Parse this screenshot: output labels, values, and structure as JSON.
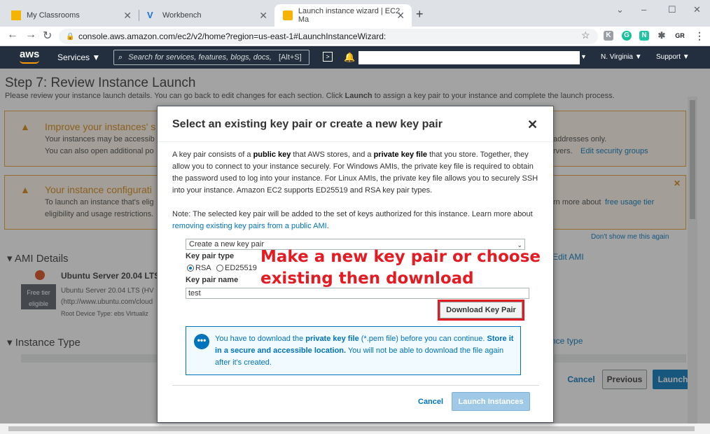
{
  "browser": {
    "tabs": [
      {
        "title": "My Classrooms"
      },
      {
        "title": "Workbench"
      },
      {
        "title": "Launch instance wizard | EC2 Ma"
      }
    ],
    "new_tab": "+",
    "window_controls": {
      "chevron": "⌄",
      "minimize": "–",
      "maximize": "☐",
      "close": "✕"
    },
    "url": "console.aws.amazon.com/ec2/v2/home?region=us-east-1#LaunchInstanceWizard:",
    "extensions": [
      {
        "letter": "K",
        "color": "#5f6368"
      },
      {
        "letter": "G",
        "color": "#15c39a"
      },
      {
        "letter": "N",
        "color": "#20c4a4"
      },
      {
        "letter": "✱",
        "color": "#5f6368"
      },
      {
        "letter": "GR",
        "color": "#202124"
      }
    ]
  },
  "aws_nav": {
    "logo": "aws",
    "services": "Services ▼",
    "search_placeholder": "Search for services, features, blogs, docs,",
    "search_shortcut": "[Alt+S]",
    "region": "N. Virginia ▼",
    "support": "Support ▼"
  },
  "page": {
    "title": "Step 7: Review Instance Launch",
    "description_pre": "Please review your instance launch details. You can go back to edit changes for each section. Click ",
    "description_bold": "Launch",
    "description_post": " to assign a key pair to your instance and complete the launch process.",
    "warning1": {
      "title": "Improve your instances' s",
      "line1": "Your instances may be accessib",
      "line1_right": "addresses only.",
      "line2": "You can also open additional po",
      "line2_right": "rvers.",
      "link": "Edit security groups"
    },
    "warning2": {
      "title": "Your instance configurati",
      "line1": "To launch an instance that's elig",
      "line1_right": "rn more about",
      "link": "free usage tier",
      "line2": "eligibility and usage restrictions."
    },
    "dont_show": "Don't show me this again",
    "ami_section": "AMI Details",
    "edit_ami": "Edit AMI",
    "ami_name": "Ubuntu Server 20.04 LTS",
    "ami_desc1": "Ubuntu Server 20.04 LTS (HV",
    "ami_desc2": "(http://www.ubuntu.com/cloud",
    "ami_root": "Root Device Type: ebs    Virtualiz",
    "free_tier": "Free tier eligible",
    "instance_section": "Instance Type",
    "edit_instance": "nce type",
    "cancel": "Cancel",
    "previous": "Previous",
    "launch": "Launch"
  },
  "modal": {
    "title": "Select an existing key pair or create a new key pair",
    "close": "✕",
    "p1_a": "A key pair consists of a ",
    "p1_b": "public key",
    "p1_c": " that AWS stores, and a ",
    "p1_d": "private key file",
    "p1_e": " that you store. Together, they allow you to connect to your instance securely. For Windows AMIs, the private key file is required to obtain the password used to log into your instance. For Linux AMIs, the private key file allows you to securely SSH into your instance. Amazon EC2 supports ED25519 and RSA key pair types.",
    "note_a": "Note: The selected key pair will be added to the set of keys authorized for this instance. Learn more about ",
    "note_link": "removing existing key pairs from a public AMI",
    "note_end": ".",
    "select_value": "Create a new key pair",
    "key_type_label": "Key pair type",
    "rsa": "RSA",
    "ed25519": "ED25519",
    "key_name_label": "Key pair name",
    "key_name_value": "test",
    "download_btn": "Download Key Pair",
    "annotation_line1": "Make a new key pair or choose",
    "annotation_line2": "existing then download",
    "info_a": "You have to download the ",
    "info_b": "private key file",
    "info_c": " (*.pem file) before you can continue. ",
    "info_d": "Store it in a secure and accessible location.",
    "info_e": " You will not be able to download the file again after it's created.",
    "cancel": "Cancel",
    "launch": "Launch Instances"
  }
}
